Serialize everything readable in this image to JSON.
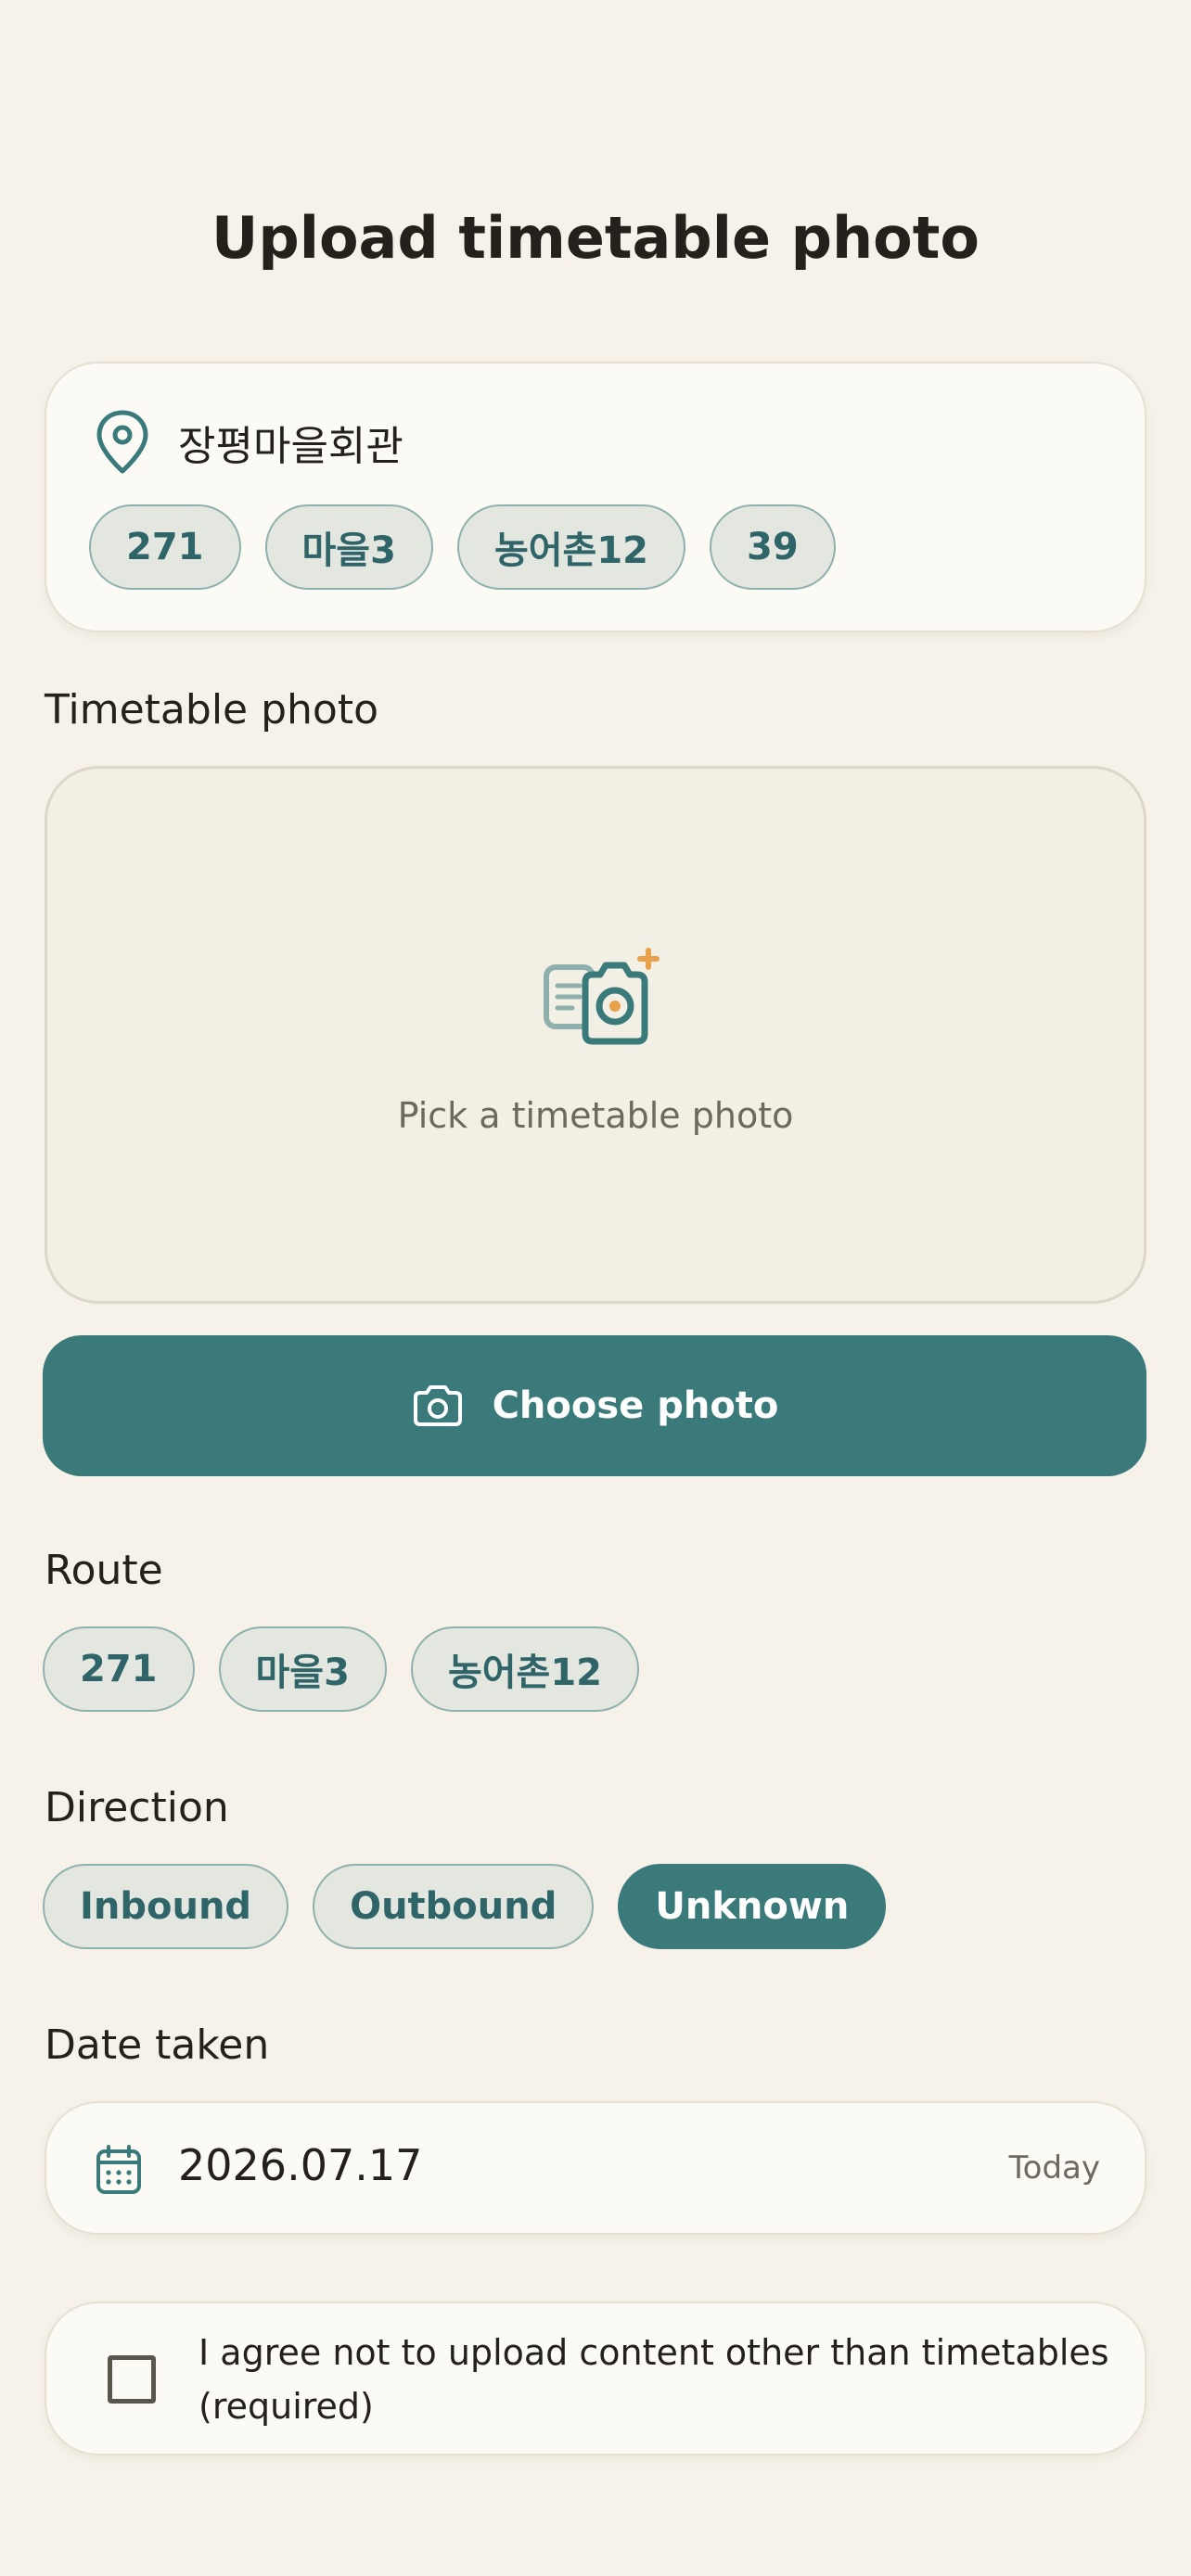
{
  "page": {
    "title": "Upload timetable photo"
  },
  "stop": {
    "icon": "map-pin-icon",
    "name": "장평마을회관",
    "routes": [
      "271",
      "마을3",
      "농어촌12",
      "39"
    ]
  },
  "photo": {
    "section_label": "Timetable photo",
    "icon": "timetable-camera-icon",
    "hint": "Pick a timetable photo",
    "button_icon": "camera-icon",
    "button_label": "Choose photo"
  },
  "route": {
    "section_label": "Route",
    "options": [
      "271",
      "마을3",
      "농어촌12"
    ]
  },
  "direction": {
    "section_label": "Direction",
    "options": [
      "Inbound",
      "Outbound",
      "Unknown"
    ],
    "selected": "Unknown"
  },
  "date": {
    "section_label": "Date taken",
    "icon": "calendar-icon",
    "value": "2026.07.17",
    "today_label": "Today"
  },
  "agreement": {
    "checked": false,
    "text": "I agree not to upload content other than timetables (required)"
  },
  "colors": {
    "background": "#f6f2e9",
    "accent": "#3a7a7a",
    "chip_bg": "#e4e6e0",
    "chip_border": "#8fb0ad",
    "chip_text": "#2f6568",
    "highlight": "#e8a04a"
  }
}
